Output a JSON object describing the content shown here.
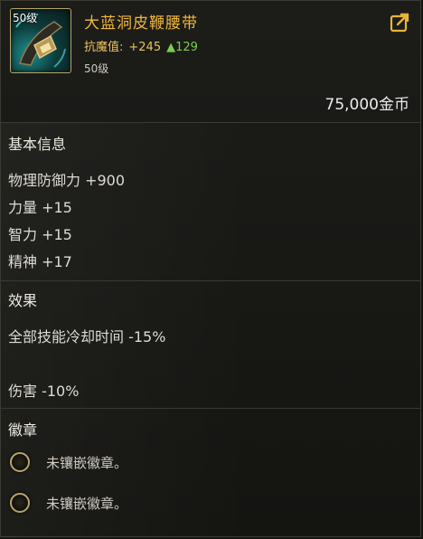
{
  "item": {
    "level_badge": "50级",
    "name": "大蓝洞皮鞭腰带",
    "stats_label": "抗魔值:",
    "stats_value": "+245",
    "stats_up": "▲129",
    "level_text": "50级",
    "icon": "belt-item-icon"
  },
  "price": "75,000金币",
  "basic": {
    "title": "基本信息",
    "lines": [
      "物理防御力 +900",
      "力量 +15",
      "智力 +15",
      "精神 +17"
    ]
  },
  "effect": {
    "title": "效果",
    "lines": [
      "全部技能冷却时间 -15%",
      "伤害 -10%"
    ]
  },
  "badge": {
    "title": "徽章",
    "slots": [
      "未镶嵌徽章。",
      "未镶嵌徽章。"
    ]
  },
  "colors": {
    "name": "#f0b63c",
    "stat": "#e9c25d",
    "up": "#79d04a",
    "frame": "#b8a46a"
  },
  "share_icon": "share-icon"
}
